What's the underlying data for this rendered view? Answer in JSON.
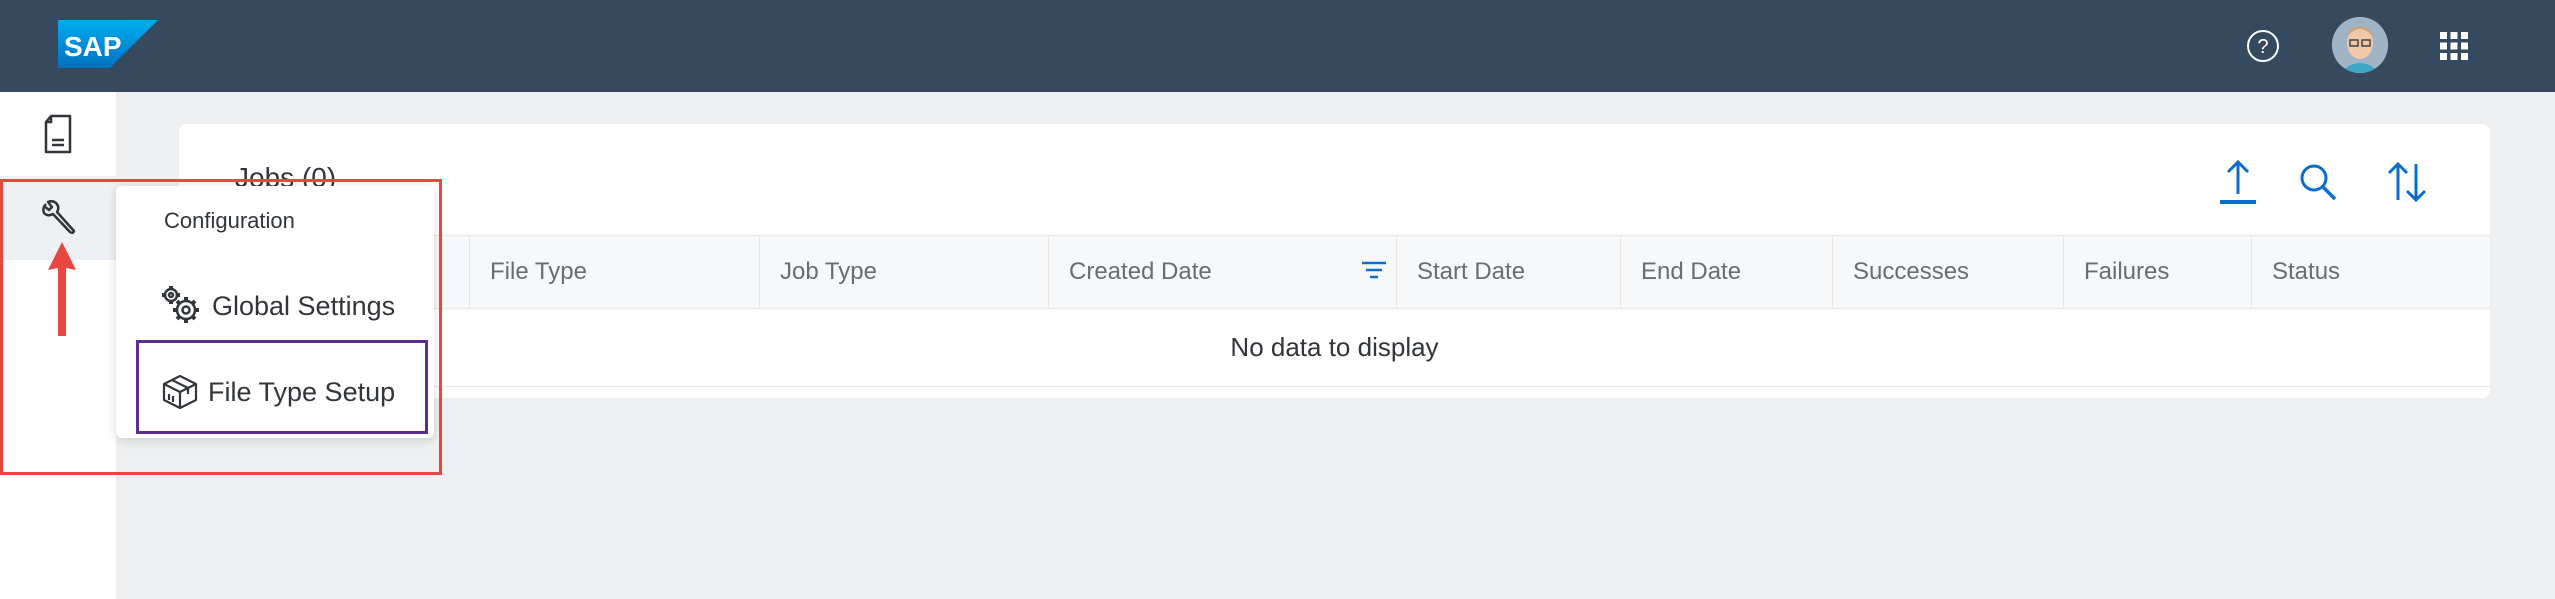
{
  "shell": {
    "logo_text": "SAP",
    "icons": [
      "help-icon",
      "avatar",
      "app-grid-icon"
    ]
  },
  "sidenav": {
    "items": [
      {
        "icon": "document-icon"
      },
      {
        "icon": "wrench-icon"
      }
    ]
  },
  "panel": {
    "title": "Jobs (0)",
    "toolbar": [
      "upload-icon",
      "search-icon",
      "sort-icon"
    ],
    "columns": [
      "File Type",
      "Job Type",
      "Created Date",
      "Start Date",
      "End Date",
      "Successes",
      "Failures",
      "Status"
    ],
    "empty_text": "No data to display"
  },
  "popover": {
    "header": "Configuration",
    "items": [
      {
        "label": "Global Settings",
        "icon": "gears-icon"
      },
      {
        "label": "File Type Setup",
        "icon": "box-icon"
      }
    ]
  },
  "colors": {
    "shell": "#354a5f",
    "accent": "#0a6ed1",
    "annotation_red": "#e8473f",
    "annotation_purple": "#5c2d91"
  }
}
